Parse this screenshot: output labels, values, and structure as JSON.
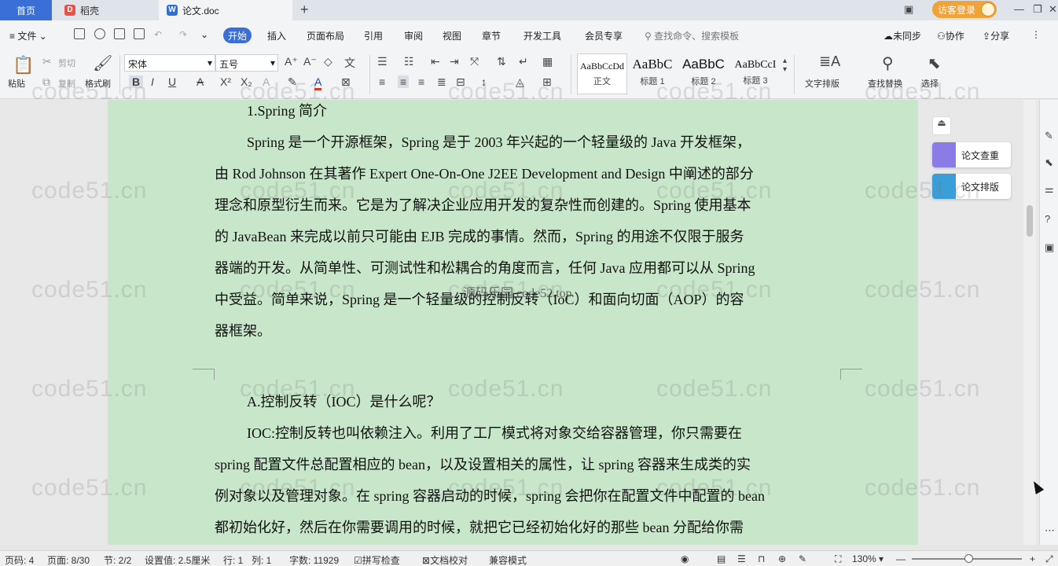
{
  "tabs": {
    "home": "首页",
    "shell": "稻壳",
    "doc": "论文.doc"
  },
  "window": {
    "guest_login": "访客登录"
  },
  "menu": {
    "file": "文件",
    "items": [
      "开始",
      "插入",
      "页面布局",
      "引用",
      "审阅",
      "视图",
      "章节",
      "开发工具",
      "会员专享"
    ],
    "search_placeholder": "查找命令、搜索模板",
    "sync": "未同步",
    "collab": "协作",
    "share": "分享"
  },
  "ribbon": {
    "paste": "粘贴",
    "cut": "剪切",
    "copy": "复制",
    "format_painter": "格式刷",
    "font_name": "宋体",
    "font_size": "五号",
    "styles": [
      {
        "sample": "AaBbCcDd",
        "name": "正文"
      },
      {
        "sample": "AaBbC",
        "name": "标题 1"
      },
      {
        "sample": "AaBbC",
        "name": "标题 2"
      },
      {
        "sample": "AaBbCcI",
        "name": "标题 3"
      }
    ],
    "text_layout": "文字排版",
    "find_replace": "查找替换",
    "select": "选择"
  },
  "document": {
    "heading1": "1.Spring 简介",
    "para1": [
      "Spring 是一个开源框架，Spring 是于 2003 年兴起的一个轻量级的 Java 开发框架，",
      "由 Rod Johnson 在其著作 Expert One-On-One J2EE Development and Design 中阐述的部分",
      "理念和原型衍生而来。它是为了解决企业应用开发的复杂性而创建的。Spring 使用基本",
      "的 JavaBean 来完成以前只可能由 EJB 完成的事情。然而，Spring 的用途不仅限于服务",
      "器端的开发。从简单性、可测试性和松耦合的角度而言，任何 Java 应用都可以从 Spring",
      "中受益。简单来说，Spring 是一个轻量级的控制反转（IoC）和面向切面（AOP）的容",
      "器框架。"
    ],
    "heading2": "A.控制反转（IOC）是什么呢？",
    "para2": [
      "IOC:控制反转也叫依赖注入。利用了工厂模式将对象交给容器管理，你只需要在",
      "spring 配置文件总配置相应的 bean，以及设置相关的属性，让 spring 容器来生成类的实",
      "例对象以及管理对象。在 spring 容器启动的时候，spring 会把你在配置文件中配置的 bean",
      "都初始化好，然后在你需要调用的时候，就把它已经初始化好的那些 bean 分配给你需"
    ],
    "overlay_text": "源码乐园 code52.top",
    "watermark": "code51.cn"
  },
  "side_panel": {
    "check": "论文查重",
    "layout": "论文排版"
  },
  "status": {
    "page_no": "页码: 4",
    "page": "页面: 8/30",
    "section": "节: 2/2",
    "setting": "设置值: 2.5厘米",
    "row": "行: 1",
    "col": "列: 1",
    "words": "字数: 11929",
    "spell": "拼写检查",
    "proof": "文档校对",
    "compat": "兼容模式",
    "zoom": "130%"
  },
  "colors": {
    "accent": "#3a6fd8",
    "page_bg": "#c8e6c9",
    "guest": "#f0a23b"
  }
}
